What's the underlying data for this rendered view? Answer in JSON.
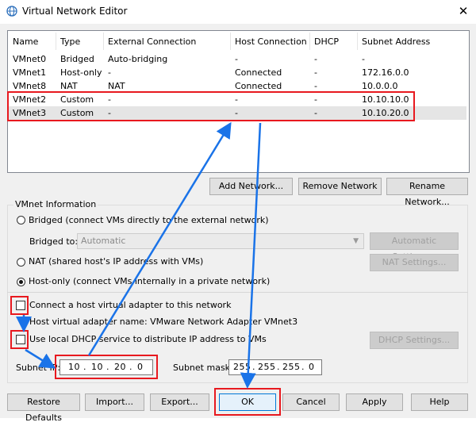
{
  "window": {
    "title": "Virtual Network Editor",
    "close_glyph": "✕"
  },
  "table": {
    "headers": [
      "Name",
      "Type",
      "External Connection",
      "Host Connection",
      "DHCP",
      "Subnet Address"
    ],
    "rows": [
      [
        "VMnet0",
        "Bridged",
        "Auto-bridging",
        "-",
        "-",
        "-"
      ],
      [
        "VMnet1",
        "Host-only",
        "-",
        "Connected",
        "-",
        "172.16.0.0"
      ],
      [
        "VMnet8",
        "NAT",
        "NAT",
        "Connected",
        "-",
        "10.0.0.0"
      ],
      [
        "VMnet2",
        "Custom",
        "-",
        "-",
        "-",
        "10.10.10.0"
      ],
      [
        "VMnet3",
        "Custom",
        "-",
        "-",
        "-",
        "10.10.20.0"
      ]
    ]
  },
  "list_buttons": {
    "add": "Add Network...",
    "remove": "Remove Network",
    "rename": "Rename Network..."
  },
  "vmnet_info": {
    "group_label": "VMnet Information",
    "bridged_label": "Bridged (connect VMs directly to the external network)",
    "bridged_to_label": "Bridged to:",
    "bridged_to_value": "Automatic",
    "auto_settings": "Automatic Settings...",
    "nat_label": "NAT (shared host's IP address with VMs)",
    "nat_settings": "NAT Settings...",
    "hostonly_label": "Host-only (connect VMs internally in a private network)",
    "connect_adapter_label": "Connect a host virtual adapter to this network",
    "adapter_name_label": "Host virtual adapter name: VMware Network Adapter VMnet3",
    "dhcp_label": "Use local DHCP service to distribute IP address to VMs",
    "dhcp_settings": "DHCP Settings...",
    "subnet_ip_label": "Subnet IP:",
    "subnet_ip": [
      "10",
      "10",
      "20",
      "0"
    ],
    "subnet_mask_label": "Subnet mask:",
    "subnet_mask": [
      "255",
      "255",
      "255",
      "0"
    ],
    "selected_mode": "host-only",
    "connect_adapter_checked": false,
    "dhcp_checked": false
  },
  "footer": {
    "restore": "Restore Defaults",
    "import": "Import...",
    "export": "Export...",
    "ok": "OK",
    "cancel": "Cancel",
    "apply": "Apply",
    "help": "Help"
  },
  "colors": {
    "highlight": "#e8191f",
    "arrow": "#1a73e8"
  }
}
